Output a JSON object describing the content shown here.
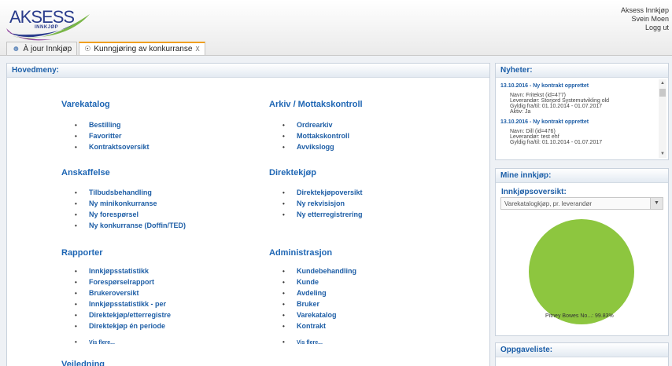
{
  "header": {
    "logo_text": "AKSESS",
    "logo_sub": "INNKJØP",
    "user_lines": [
      "Aksess Innkjøp",
      "Svein Moen"
    ],
    "logout": "Logg ut"
  },
  "tabs": [
    {
      "label": "À jour Innkjøp",
      "icon": "people-icon"
    },
    {
      "label": "Kunngjøring av konkurranse",
      "icon": "trophy-icon",
      "close": "X",
      "active": true
    }
  ],
  "main": {
    "title": "Hovedmeny:",
    "sections": [
      {
        "title": "Varekatalog",
        "items": [
          "Bestilling",
          "Favoritter",
          "Kontraktsoversikt"
        ]
      },
      {
        "title": "Arkiv / Mottakskontroll",
        "items": [
          "Ordrearkiv",
          "Mottakskontroll",
          "Avvikslogg"
        ]
      },
      {
        "title": "Anskaffelse",
        "items": [
          "Tilbudsbehandling",
          "Ny minikonkurranse",
          "Ny forespørsel",
          "Ny konkurranse (Doffin/TED)"
        ]
      },
      {
        "title": "Direktekjøp",
        "items": [
          "Direktekjøpoversikt",
          "Ny rekvisisjon",
          "Ny etterregistrering"
        ]
      },
      {
        "title": "Rapporter",
        "items": [
          "Innkjøpsstatistikk",
          "Forespørselrapport",
          "Brukeroversikt",
          "Innkjøpsstatistikk - per",
          "Direktekjøp/etterregistre",
          "Direktekjøp én periode"
        ],
        "more": "Vis flere..."
      },
      {
        "title": "Administrasjon",
        "items": [
          "Kundebehandling",
          "Kunde",
          "Avdeling",
          "Bruker",
          "Varekatalog",
          "Kontrakt"
        ],
        "more": "Vis flere..."
      },
      {
        "title": "Veiledning",
        "items": []
      }
    ]
  },
  "news": {
    "title": "Nyheter:",
    "entries": [
      {
        "headline": "13.10.2016 - Ny kontrakt opprettet",
        "lines": [
          "Navn: Fritekst (id=477)",
          "Leverandør: Storjord Systemutvikling old",
          "Gyldig fra/til: 01.10.2014 - 01.07.2017",
          "Aktiv: Ja"
        ]
      },
      {
        "headline": "13.10.2016 - Ny kontrakt opprettet",
        "lines": [
          "Navn: Dill (id=476)",
          "Leverandør: test ehf",
          "Gyldig fra/til: 01.10.2014 - 01.07.2017"
        ]
      }
    ]
  },
  "mine": {
    "title": "Mine innkjøp:",
    "sub_label": "Innkjøpsoversikt:",
    "select_value": "Varekatalogkjøp, pr. leverandør"
  },
  "chart_data": {
    "type": "pie",
    "slices": [
      {
        "label": "Pitney Bowes No...: 99.83%",
        "value": 99.83,
        "color": "#8dc63f"
      }
    ]
  },
  "oppgave": {
    "title": "Oppgaveliste:"
  },
  "colors": {
    "accent": "#1e5ea6",
    "tab_active": "#f0a020",
    "pie": "#8dc63f"
  }
}
